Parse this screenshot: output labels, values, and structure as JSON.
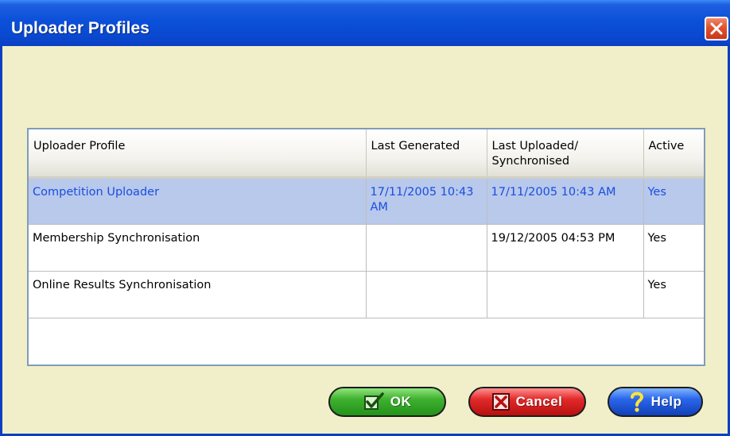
{
  "window": {
    "title": "Uploader Profiles"
  },
  "table": {
    "headers": [
      "Uploader Profile",
      "Last Generated",
      "Last Uploaded/ Synchronised",
      "Active"
    ],
    "rows": [
      {
        "profile": "Competition Uploader",
        "last_generated": "17/11/2005 10:43 AM",
        "last_uploaded": "17/11/2005 10:43 AM",
        "active": "Yes",
        "selected": true
      },
      {
        "profile": "Membership Synchronisation",
        "last_generated": "",
        "last_uploaded": "19/12/2005 04:53 PM",
        "active": "Yes",
        "selected": false
      },
      {
        "profile": "Online Results Synchronisation",
        "last_generated": "",
        "last_uploaded": "",
        "active": "Yes",
        "selected": false
      }
    ]
  },
  "buttons": {
    "ok": "OK",
    "cancel": "Cancel",
    "help": "Help"
  },
  "colors": {
    "title_bar": "#0a48cf",
    "dialog_background": "#f1efca",
    "selected_row": "#b8c9eb",
    "selected_text": "#1a4de0",
    "ok_button": "#3fb12f",
    "cancel_button": "#e22a2a",
    "help_button": "#2a66ea"
  },
  "icons": {
    "close": "close-icon",
    "ok": "checkmark-icon",
    "cancel": "x-icon",
    "help": "question-mark-icon"
  }
}
